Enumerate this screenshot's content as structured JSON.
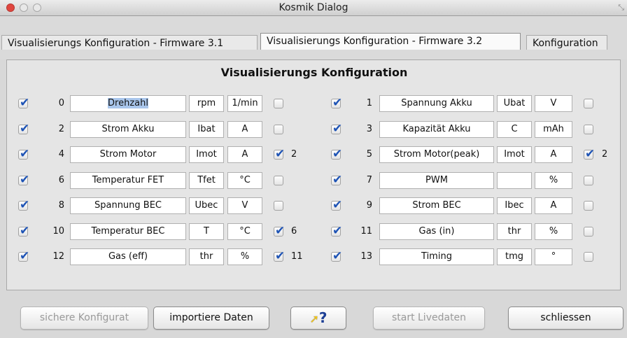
{
  "window": {
    "title": "Kosmik Dialog",
    "accent": "#1f54b5"
  },
  "tabs": [
    {
      "label": "Visualisierungs Konfiguration - Firmware 3.1",
      "active": false
    },
    {
      "label": "Visualisierungs Konfiguration - Firmware 3.2",
      "active": true
    },
    {
      "label": "Konfiguration",
      "active": false
    }
  ],
  "panel": {
    "heading": "Visualisierungs Konfiguration"
  },
  "rows": [
    {
      "enabled": true,
      "index": "0",
      "name": "Drehzahl",
      "symbol": "rpm",
      "unit": "1/min",
      "linked": false,
      "link": ""
    },
    {
      "enabled": true,
      "index": "1",
      "name": "Spannung Akku",
      "symbol": "Ubat",
      "unit": "V",
      "linked": false,
      "link": ""
    },
    {
      "enabled": true,
      "index": "2",
      "name": "Strom Akku",
      "symbol": "Ibat",
      "unit": "A",
      "linked": false,
      "link": ""
    },
    {
      "enabled": true,
      "index": "3",
      "name": "Kapazität Akku",
      "symbol": "C",
      "unit": "mAh",
      "linked": false,
      "link": ""
    },
    {
      "enabled": true,
      "index": "4",
      "name": "Strom Motor",
      "symbol": "Imot",
      "unit": "A",
      "linked": true,
      "link": "2"
    },
    {
      "enabled": true,
      "index": "5",
      "name": "Strom Motor(peak)",
      "symbol": "Imot",
      "unit": "A",
      "linked": true,
      "link": "2"
    },
    {
      "enabled": true,
      "index": "6",
      "name": "Temperatur FET",
      "symbol": "Tfet",
      "unit": "°C",
      "linked": false,
      "link": ""
    },
    {
      "enabled": true,
      "index": "7",
      "name": "PWM",
      "symbol": "",
      "unit": "%",
      "linked": false,
      "link": ""
    },
    {
      "enabled": true,
      "index": "8",
      "name": "Spannung BEC",
      "symbol": "Ubec",
      "unit": "V",
      "linked": false,
      "link": ""
    },
    {
      "enabled": true,
      "index": "9",
      "name": "Strom BEC",
      "symbol": "Ibec",
      "unit": "A",
      "linked": false,
      "link": ""
    },
    {
      "enabled": true,
      "index": "10",
      "name": "Temperatur BEC",
      "symbol": "T",
      "unit": "°C",
      "linked": true,
      "link": "6"
    },
    {
      "enabled": true,
      "index": "11",
      "name": "Gas (in)",
      "symbol": "thr",
      "unit": "%",
      "linked": false,
      "link": ""
    },
    {
      "enabled": true,
      "index": "12",
      "name": "Gas (eff)",
      "symbol": "thr",
      "unit": "%",
      "linked": true,
      "link": "11"
    },
    {
      "enabled": true,
      "index": "13",
      "name": "Timing",
      "symbol": "tmg",
      "unit": "°",
      "linked": false,
      "link": ""
    }
  ],
  "buttons": {
    "save": "sichere Konfigurat",
    "import": "importiere Daten",
    "help": "?",
    "live": "start Livedaten",
    "close": "schliessen"
  }
}
